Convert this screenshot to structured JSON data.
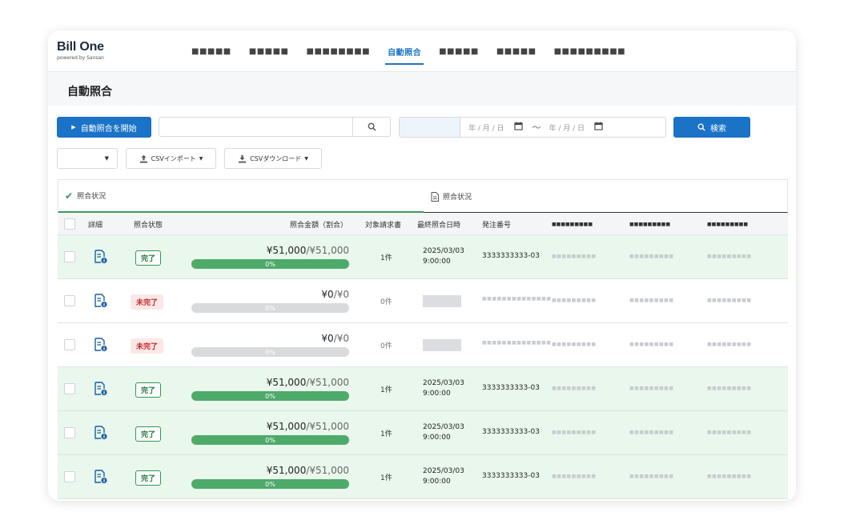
{
  "brand": {
    "name": "Bill One",
    "tagline": "powered by Sansan"
  },
  "nav": [
    {
      "label": "■■■■■"
    },
    {
      "label": "■■■■■"
    },
    {
      "label": "■■■■■■■■"
    },
    {
      "label": "自動照合",
      "active": true
    },
    {
      "label": "■■■■■"
    },
    {
      "label": "■■■■■"
    },
    {
      "label": "■■■■■■■■■"
    }
  ],
  "page_title": "自動照合",
  "toolbar": {
    "start_label": "自動照合を開始",
    "search_value": "",
    "date_from_placeholder": "年 / 月 / 日",
    "date_to_placeholder": "年 / 月 / 日",
    "range_separator": "〜",
    "search_button": "検索",
    "filter_select_value": "",
    "csv_import": "CSVインポート",
    "csv_download": "CSVダウンロード"
  },
  "tabs": [
    {
      "label": "照合状況",
      "icon": "check-icon",
      "active": true
    },
    {
      "label": "照合状況",
      "icon": "document-icon",
      "active": false
    }
  ],
  "columns": [
    "詳細",
    "照合状態",
    "照合金額（割合）",
    "対象請求書",
    "最終照合日時",
    "発注番号",
    "■■■■■■■■■",
    "■■■■■■■■■",
    "■■■■■■■■■"
  ],
  "rows": [
    {
      "status": "完了",
      "done": true,
      "amount": "¥51,000",
      "total": "/¥51,000",
      "progress_label": "0%",
      "progress": 1.0,
      "count": "1件",
      "date": "2025/03/03",
      "time": "9:00:00",
      "order": "3333333333-03",
      "m1": "■■■■■■■■■",
      "m2": "■■■■■■■■■",
      "m3": "■■■■■■■■■"
    },
    {
      "status": "未完了",
      "done": false,
      "amount": "¥0",
      "total": "/¥0",
      "progress_label": "0%",
      "progress": 0.0,
      "count": "0件",
      "date": "",
      "time": "",
      "order": "■■■■■■■■■■■■■■",
      "m1": "■■■■■■■■■",
      "m2": "■■■■■■■■■",
      "m3": "■■■■■■■■■"
    },
    {
      "status": "未完了",
      "done": false,
      "amount": "¥0",
      "total": "/¥0",
      "progress_label": "0%",
      "progress": 0.0,
      "count": "0件",
      "date": "",
      "time": "",
      "order": "■■■■■■■■■■■■■■",
      "m1": "■■■■■■■■■",
      "m2": "■■■■■■■■■",
      "m3": "■■■■■■■■■"
    },
    {
      "status": "完了",
      "done": true,
      "amount": "¥51,000",
      "total": "/¥51,000",
      "progress_label": "0%",
      "progress": 1.0,
      "count": "1件",
      "date": "2025/03/03",
      "time": "9:00:00",
      "order": "3333333333-03",
      "m1": "■■■■■■■■■",
      "m2": "■■■■■■■■■",
      "m3": "■■■■■■■■■"
    },
    {
      "status": "完了",
      "done": true,
      "amount": "¥51,000",
      "total": "/¥51,000",
      "progress_label": "0%",
      "progress": 1.0,
      "count": "1件",
      "date": "2025/03/03",
      "time": "9:00:00",
      "order": "3333333333-03",
      "m1": "■■■■■■■■■",
      "m2": "■■■■■■■■■",
      "m3": "■■■■■■■■■"
    },
    {
      "status": "完了",
      "done": true,
      "amount": "¥51,000",
      "total": "/¥51,000",
      "progress_label": "0%",
      "progress": 1.0,
      "count": "1件",
      "date": "2025/03/03",
      "time": "9:00:00",
      "order": "3333333333-03",
      "m1": "■■■■■■■■■",
      "m2": "■■■■■■■■■",
      "m3": "■■■■■■■■■"
    }
  ],
  "colors": {
    "accent": "#1a73c7",
    "success": "#4eaa6a",
    "done_row": "#e9f7ec",
    "danger": "#c62828"
  }
}
